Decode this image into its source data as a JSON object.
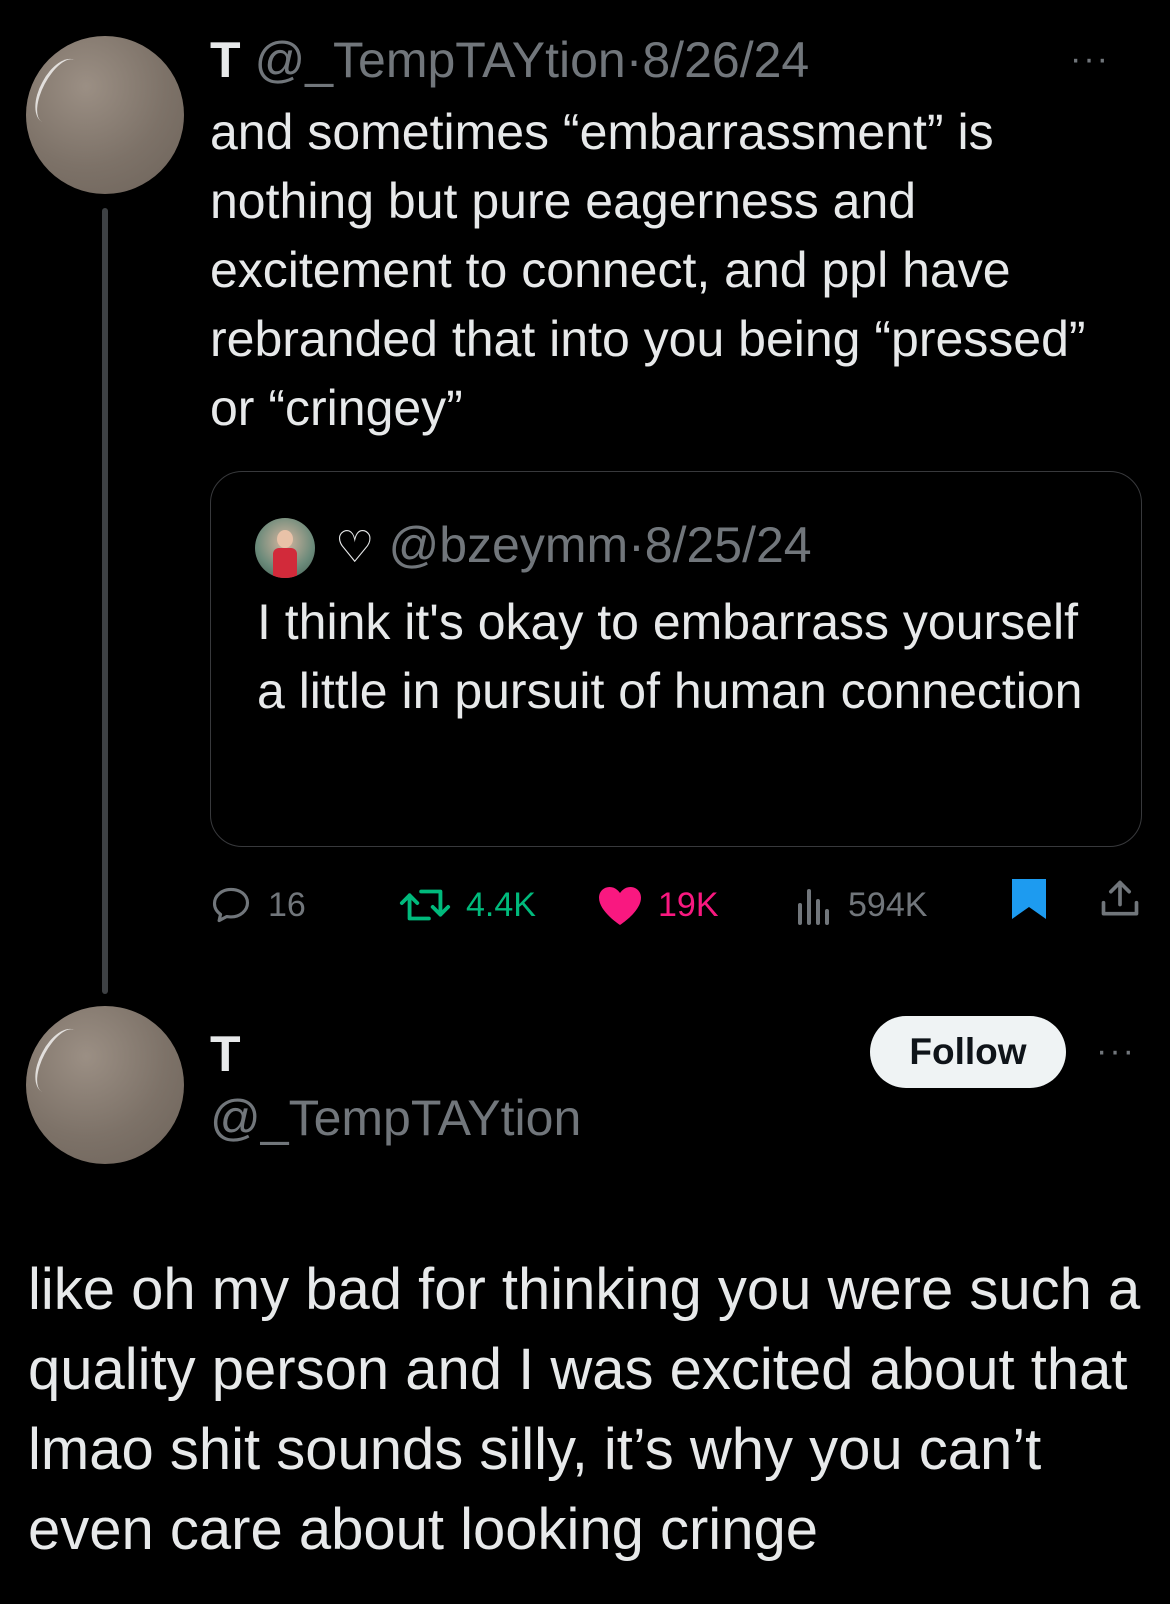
{
  "tweet1": {
    "display_name": "T",
    "handle": "@_TempTAYtion",
    "separator": "·",
    "date": "8/26/24",
    "more_label": "···",
    "text": "and sometimes “embarrassment” is nothing but pure eagerness and excitement to connect, and ppl have rebranded that into you being “pressed” or “cringey”",
    "quoted": {
      "display_name": "♡",
      "handle": "@bzeymm",
      "separator": "·",
      "date": "8/25/24",
      "text": "I think it's okay to embarrass yourself a little in pursuit of human connection"
    },
    "actions": {
      "replies": "16",
      "reposts": "4.4K",
      "likes": "19K",
      "views": "594K"
    },
    "colors": {
      "repost": "#00ba7c",
      "like": "#f91880",
      "bookmark": "#1d9bf0",
      "muted": "#71767b"
    }
  },
  "tweet2": {
    "display_name": "T",
    "handle": "@_TempTAYtion",
    "follow_label": "Follow",
    "more_label": "···",
    "text": "like oh my bad for thinking you were such a quality person and I was excited about that lmao shit sounds silly, it’s why you can’t even care about looking cringe"
  }
}
